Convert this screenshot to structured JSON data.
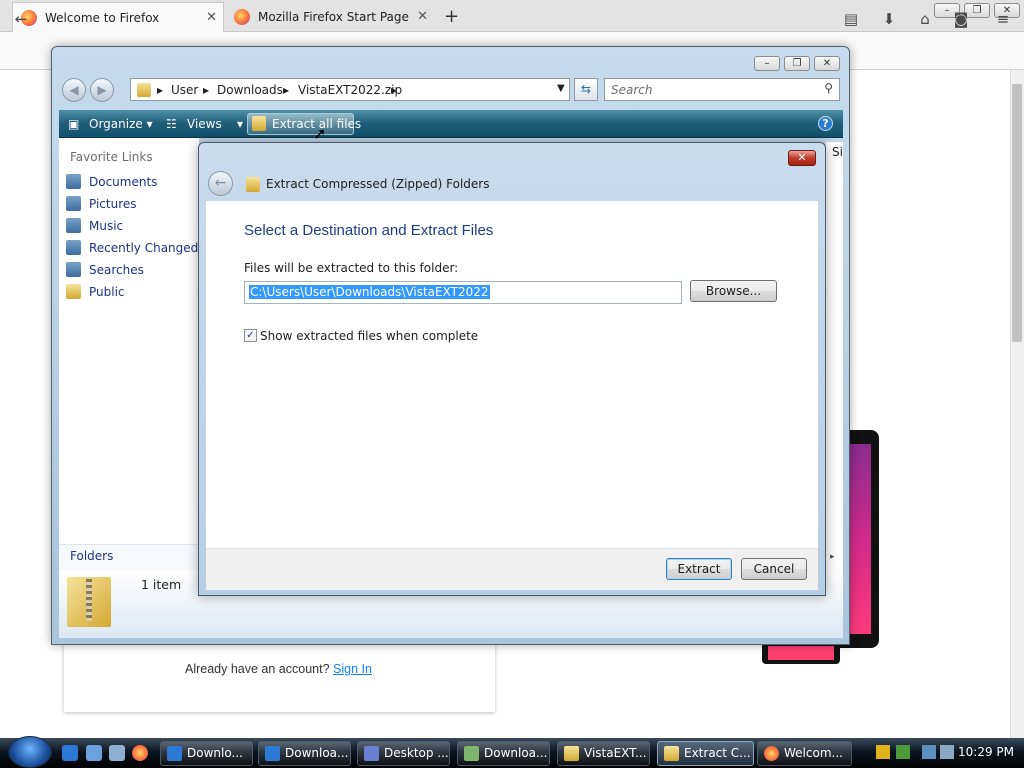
{
  "browser": {
    "tabs": [
      {
        "label": "Welcome to Firefox",
        "active": true
      },
      {
        "label": "Mozilla Firefox Start Page",
        "active": false
      }
    ],
    "new_tab": "+",
    "window_controls": [
      "–",
      "❐",
      "✕"
    ],
    "icons": [
      "back-icon",
      "info-icon",
      "bookmarks-icon",
      "download-icon",
      "home-icon",
      "pocket-icon",
      "menu-icon"
    ]
  },
  "page": {
    "already_text": "Already have an account?",
    "sign_in": "Sign In"
  },
  "explorer": {
    "breadcrumb": [
      "User",
      "Downloads",
      "VistaEXT2022.zip"
    ],
    "search_placeholder": "Search",
    "toolbar": {
      "organize": "Organize",
      "views": "Views",
      "extract_all": "Extract all files"
    },
    "favorite_links_title": "Favorite Links",
    "favorite_links": [
      "Documents",
      "Pictures",
      "Music",
      "Recently Changed",
      "Searches",
      "Public"
    ],
    "column_fragment": "Si",
    "folders_label": "Folders",
    "item_count": "1 item"
  },
  "dialog": {
    "title": "Extract Compressed (Zipped) Folders",
    "heading": "Select a Destination and Extract Files",
    "label": "Files will be extracted to this folder:",
    "path": "C:\\Users\\User\\Downloads\\VistaEXT2022",
    "browse": "Browse...",
    "checkbox_label": "Show extracted files when complete",
    "checkbox_checked": true,
    "extract": "Extract",
    "cancel": "Cancel"
  },
  "taskbar": {
    "buttons": [
      {
        "label": "Downlo...",
        "icon": "ie-icon",
        "active": false
      },
      {
        "label": "Downloa...",
        "icon": "ie-icon",
        "active": false
      },
      {
        "label": "Desktop ...",
        "icon": "desktop-icon",
        "active": false
      },
      {
        "label": "Downloa...",
        "icon": "folder-icon",
        "active": false
      },
      {
        "label": "VistaEXT...",
        "icon": "zip-folder-icon",
        "active": false
      },
      {
        "label": "Extract C...",
        "icon": "zip-folder-icon",
        "active": true
      },
      {
        "label": "Welcom...",
        "icon": "firefox-icon",
        "active": false
      }
    ],
    "clock": "10:29 PM"
  }
}
